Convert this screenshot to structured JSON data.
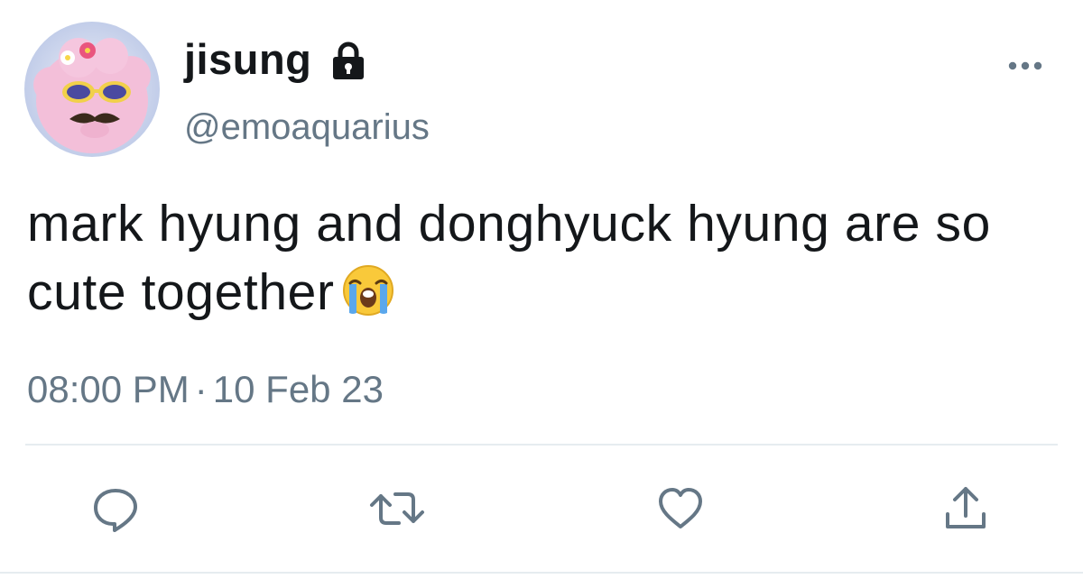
{
  "tweet": {
    "display_name": "jisung",
    "handle": "@emoaquarius",
    "protected_icon": "lock-icon",
    "text": "mark hyung and donghyuck hyung are so cute together",
    "emoji": "loudly-crying-face-emoji",
    "time": "08:00 PM",
    "separator": "·",
    "date": "10 Feb 23"
  },
  "actions": [
    {
      "name": "reply",
      "icon": "reply-icon"
    },
    {
      "name": "retweet",
      "icon": "retweet-icon"
    },
    {
      "name": "like",
      "icon": "heart-icon"
    },
    {
      "name": "share",
      "icon": "share-icon"
    }
  ],
  "colors": {
    "text_primary": "#14171a",
    "text_secondary": "#657786",
    "icon": "#657786",
    "divider": "#e6ecf0"
  }
}
